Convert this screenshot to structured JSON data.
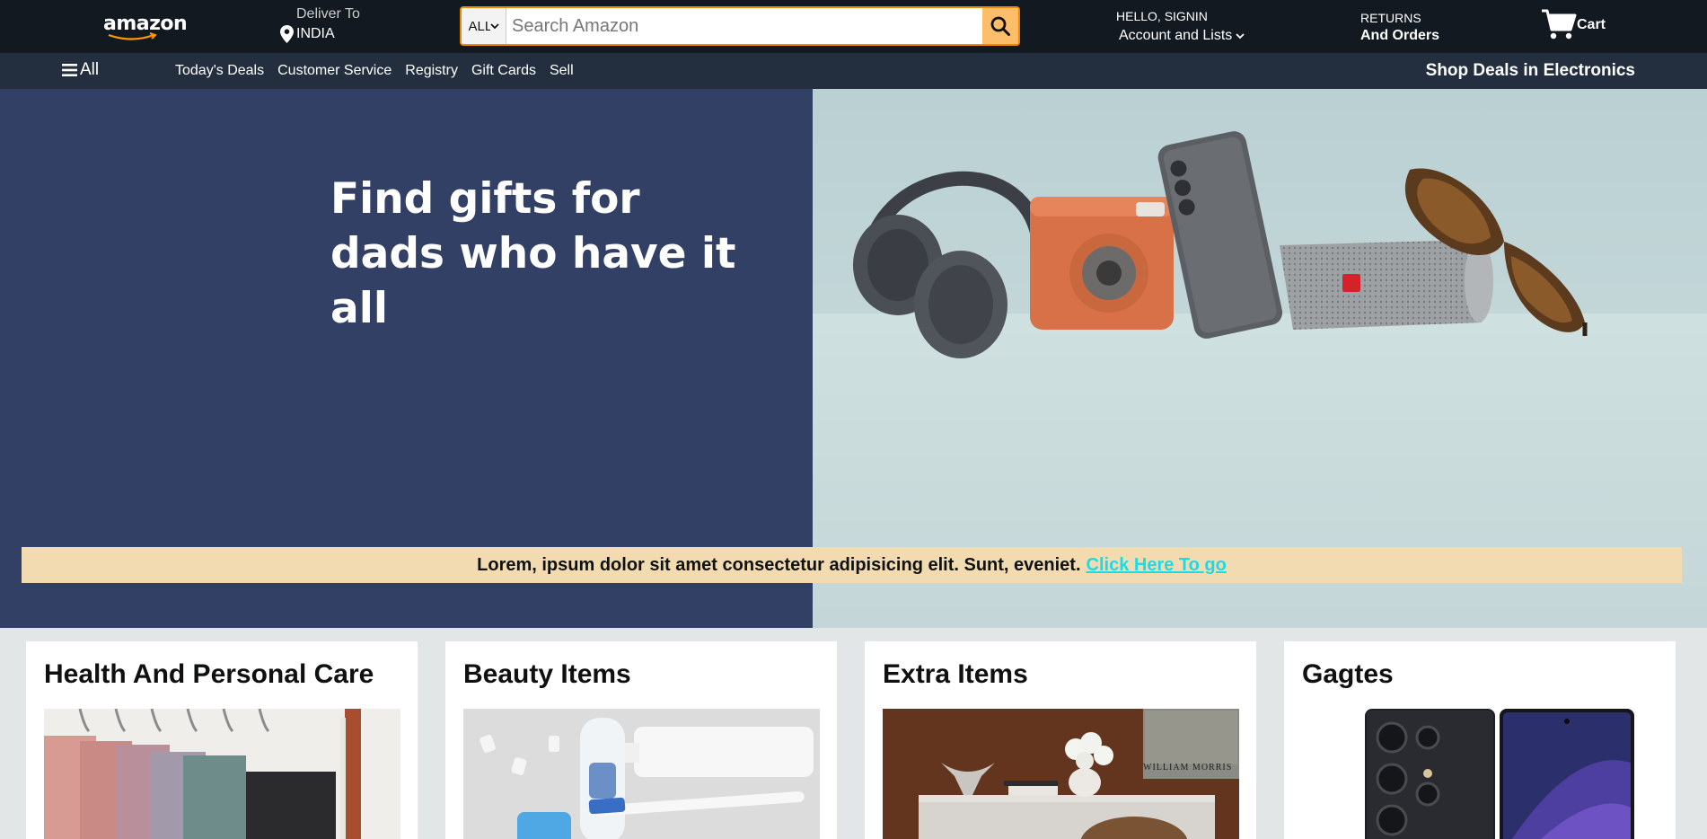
{
  "header": {
    "logo_text": "amazon",
    "deliver": {
      "line1": "Deliver To",
      "location": "INDIA",
      "icon": "location-pin-icon"
    },
    "search": {
      "category": "ALL",
      "placeholder": "Search Amazon",
      "button_icon": "search-icon"
    },
    "account": {
      "greeting": "HELLO, SIGNIN",
      "label": "Account and Lists"
    },
    "returns": {
      "line1": "RETURNS",
      "line2": "And Orders"
    },
    "cart": {
      "label": "Cart",
      "icon": "cart-icon"
    }
  },
  "subnav": {
    "all_label": "All",
    "links": [
      "Today's Deals",
      "Customer Service",
      "Registry",
      "Gift Cards",
      "Sell"
    ],
    "promo": "Shop Deals in Electronics"
  },
  "hero": {
    "title_line1": "Find gifts for",
    "title_line2": "dads who have it all",
    "banner_text": "Lorem, ipsum dolor sit amet consectetur adipisicing elit. Sunt, eveniet.",
    "banner_link": "Click Here To go"
  },
  "cards": [
    {
      "title": "Health And Personal Care"
    },
    {
      "title": "Beauty Items"
    },
    {
      "title": "Extra Items",
      "image_caption": "WILLIAM MORRIS"
    },
    {
      "title": "Gagtes"
    }
  ],
  "colors": {
    "nav_bg": "#131921",
    "subnav_bg": "#232f3e",
    "hero_left_bg": "#334066",
    "search_button": "#febd69",
    "banner_bg": "#f2dbb0",
    "banner_link": "#1ddbe6"
  }
}
